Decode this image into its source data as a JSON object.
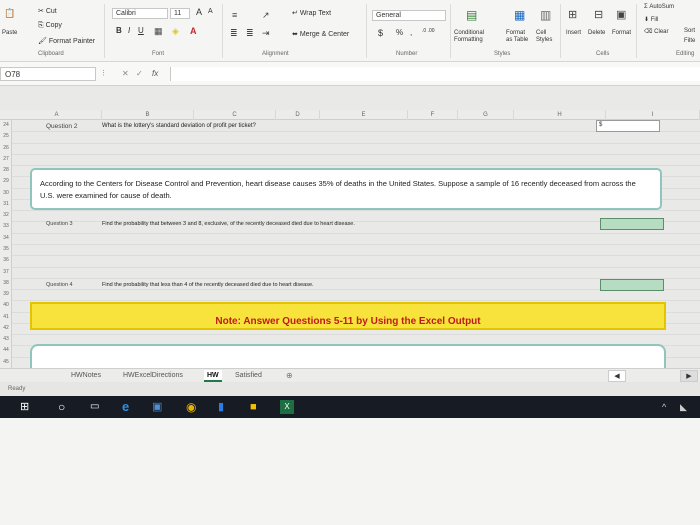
{
  "ribbon": {
    "clipboard": {
      "cut": "Cut",
      "copy": "Copy",
      "paste": "Paste",
      "format_painter": "Format Painter",
      "label": "Clipboard"
    },
    "font": {
      "name": "Calibri",
      "size": "11",
      "grow": "A",
      "shrink": "A",
      "bold": "B",
      "italic": "I",
      "underline": "U",
      "label": "Font"
    },
    "alignment": {
      "wrap": "Wrap Text",
      "merge": "Merge & Center",
      "label": "Alignment"
    },
    "number": {
      "format": "General",
      "currency": "$",
      "percent": "%",
      "comma": ",",
      "inc_dec": ".0 .00",
      "label": "Number"
    },
    "styles": {
      "conditional": "Conditional Formatting",
      "format_table": "Format as Table",
      "cell_styles": "Cell Styles",
      "label": "Styles"
    },
    "cells": {
      "insert": "Insert",
      "delete": "Delete",
      "format": "Format",
      "label": "Cells"
    },
    "editing": {
      "autosum": "AutoSum",
      "fill": "Fill",
      "clear": "Clear",
      "sort": "Sort",
      "filter": "Filte",
      "label": "Editing"
    }
  },
  "formula_bar": {
    "name_box": "O78",
    "cancel": "✕",
    "enter": "✓",
    "fx": "fx",
    "value": ""
  },
  "columns": [
    "A",
    "B",
    "C",
    "D",
    "E",
    "F",
    "G",
    "H",
    "I"
  ],
  "rows": [
    "24",
    "25",
    "26",
    "27",
    "28",
    "29",
    "30",
    "31",
    "32",
    "33",
    "34",
    "35",
    "36",
    "37",
    "38",
    "39",
    "40",
    "41",
    "42",
    "43",
    "44",
    "45"
  ],
  "sheet": {
    "q2_label": "Question 2",
    "q2_text": "What is the lottery's standard deviation of profit per ticket?",
    "q2_value": "$",
    "textbox": "According to the Centers for Disease Control and Prevention, heart disease causes 35% of deaths in the United States. Suppose a sample of 16 recently deceased from across the U.S. were examined for cause of death.",
    "q3_label": "Question 3",
    "q3_text": "Find the probability that between 3 and 8, exclusive, of the recently deceased died due to heart disease.",
    "q4_label": "Question 4",
    "q4_text": "Find the probability that less than 4 of the recently deceased died due to heart disease.",
    "note": "Note: Answer Questions 5-11 by Using the Excel Output"
  },
  "tabs": [
    "HWNotes",
    "HWExcelDirections",
    "HW",
    "Satisfied"
  ],
  "active_tab": "HW",
  "status": {
    "text": "Ready"
  },
  "colors": {
    "note_bg": "#f8e23c",
    "note_text": "#c11a1a",
    "answer_fill": "#b6dcc2",
    "textbox_border": "#8fc5bd"
  }
}
